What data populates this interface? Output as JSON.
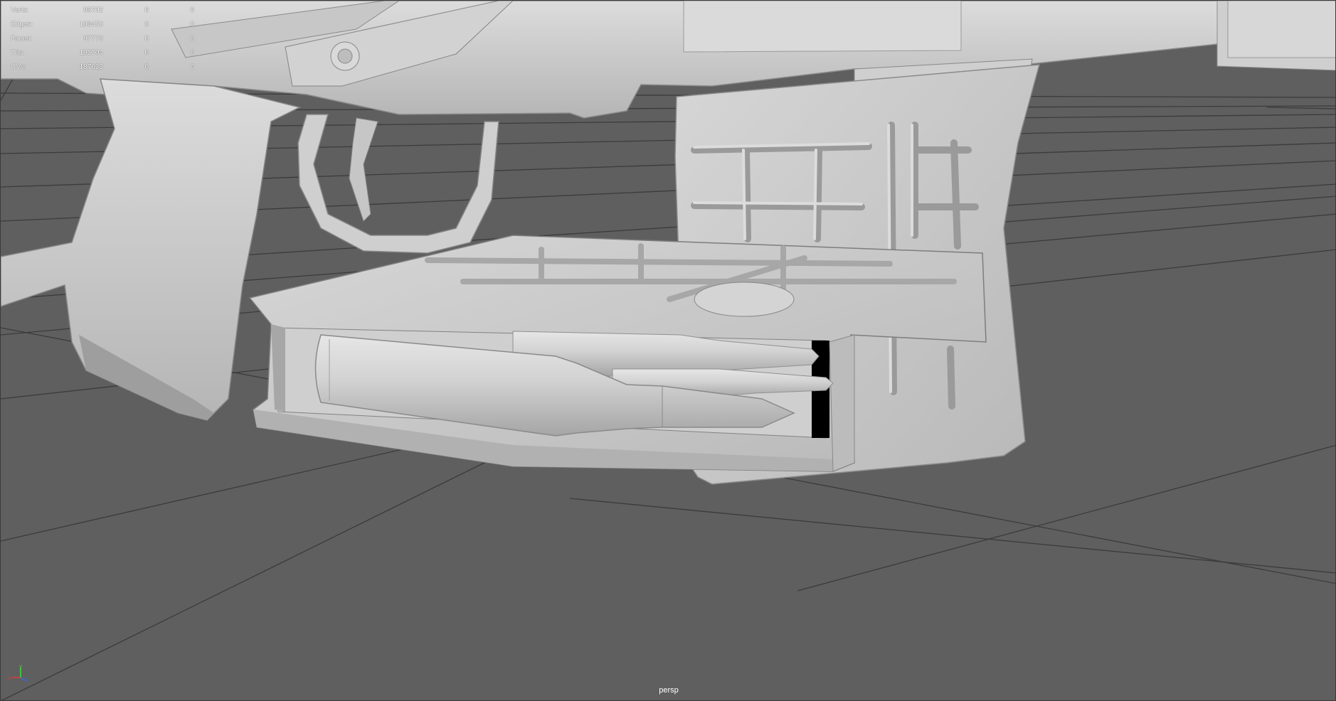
{
  "hud": {
    "rows": [
      {
        "label": "Verts:",
        "value": "98702",
        "selected": "0",
        "uv": "0"
      },
      {
        "label": "Edges:",
        "value": "196450",
        "selected": "0",
        "uv": "0"
      },
      {
        "label": "Faces:",
        "value": "97779",
        "selected": "0",
        "uv": "0"
      },
      {
        "label": "Tris:",
        "value": "195704",
        "selected": "0",
        "uv": "0"
      },
      {
        "label": "UVs:",
        "value": "187623",
        "selected": "0",
        "uv": "0"
      }
    ]
  },
  "viewport": {
    "camera": "persp",
    "background_color": "#5f5f5f",
    "grid_color": "#3c3c3c",
    "model_color": "#c9c9c9"
  },
  "axis_gizmo": {
    "x": "x",
    "y": "y",
    "z": "z"
  }
}
